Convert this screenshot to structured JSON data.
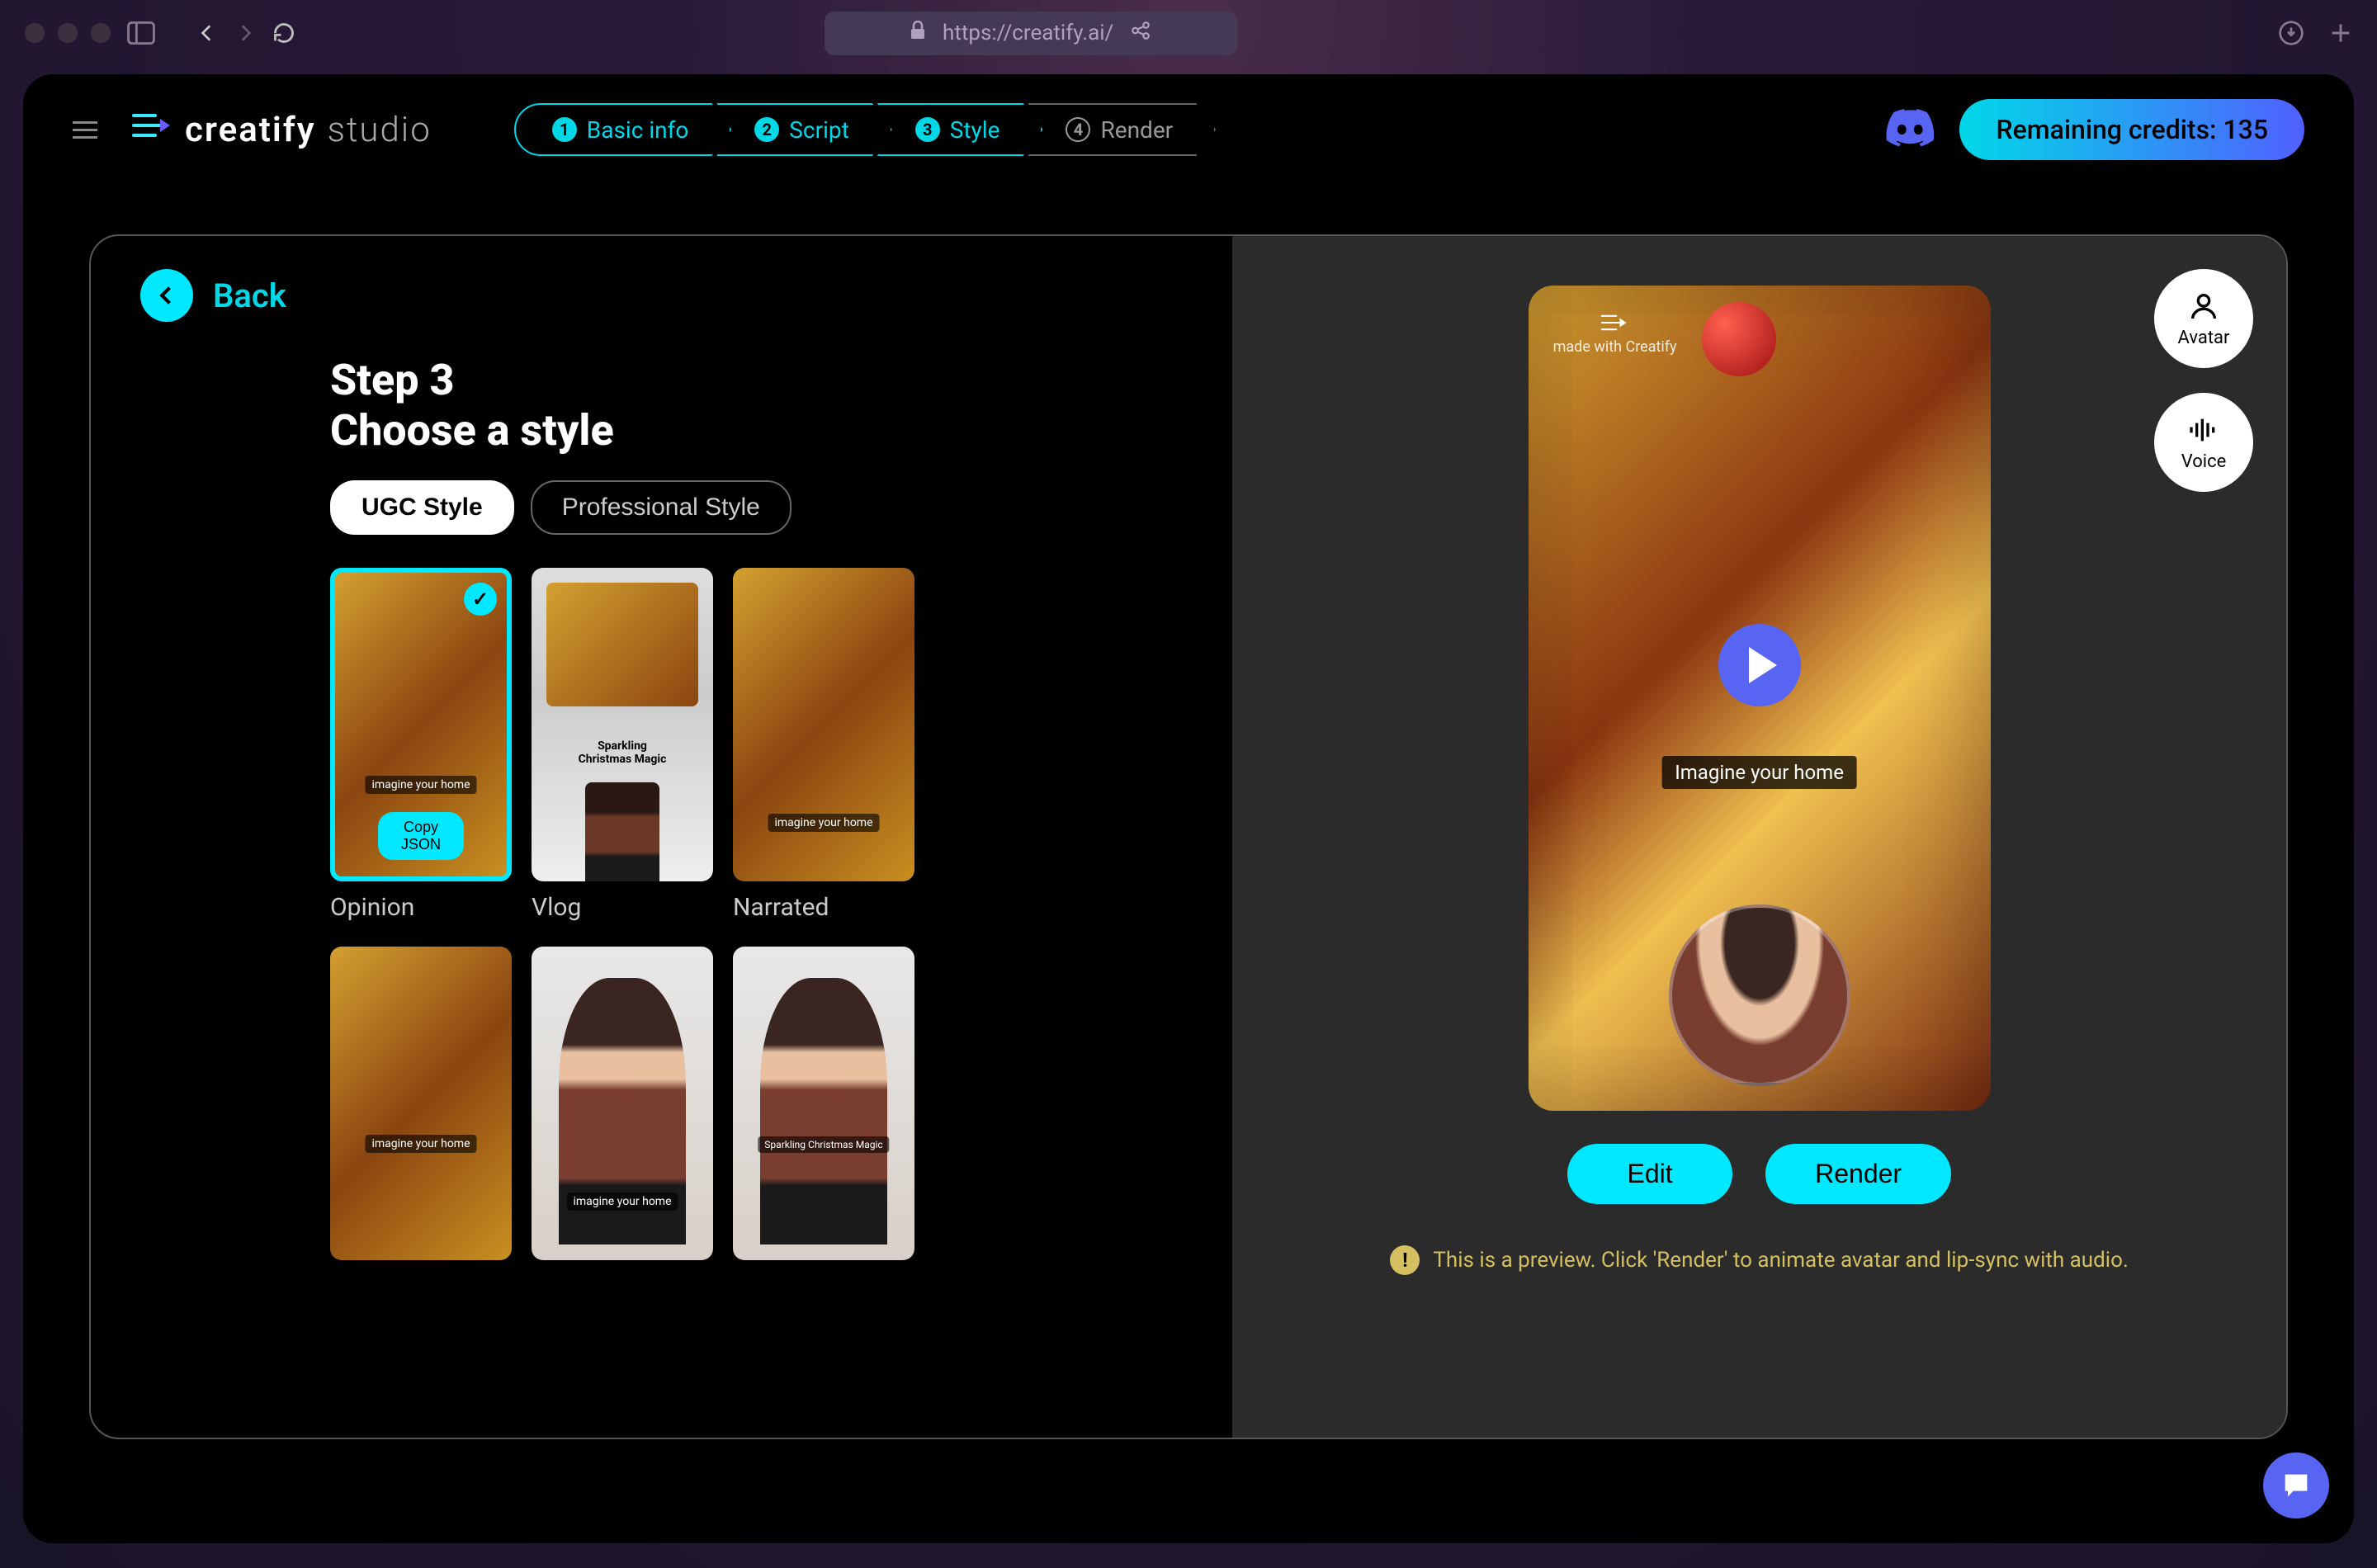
{
  "browser": {
    "url": "https://creatify.ai/"
  },
  "brand": {
    "name": "creatify",
    "suffix": "studio"
  },
  "stepper": {
    "s1": "Basic info",
    "s2": "Script",
    "s3": "Style",
    "s4": "Render",
    "n1": "1",
    "n2": "2",
    "n3": "3",
    "n4": "4"
  },
  "credits": "Remaining credits: 135",
  "back": "Back",
  "heading": {
    "line1": "Step 3",
    "line2": "Choose a style"
  },
  "tabs": {
    "ugc": "UGC Style",
    "pro": "Professional Style"
  },
  "cards": {
    "opinion": "Opinion",
    "vlog": "Vlog",
    "narrated": "Narrated",
    "vlog_text_l1": "Sparkling",
    "vlog_text_l2": "Christmas Magic",
    "caption_small": "imagine your home",
    "sparkling_caption": "Sparkling Christmas Magic"
  },
  "copy_json": "Copy JSON",
  "side": {
    "avatar": "Avatar",
    "voice": "Voice"
  },
  "preview": {
    "watermark": "made with Creatify",
    "caption": "Imagine your home"
  },
  "actions": {
    "edit": "Edit",
    "render": "Render"
  },
  "note": "This is a preview. Click 'Render' to animate avatar and lip-sync with audio."
}
